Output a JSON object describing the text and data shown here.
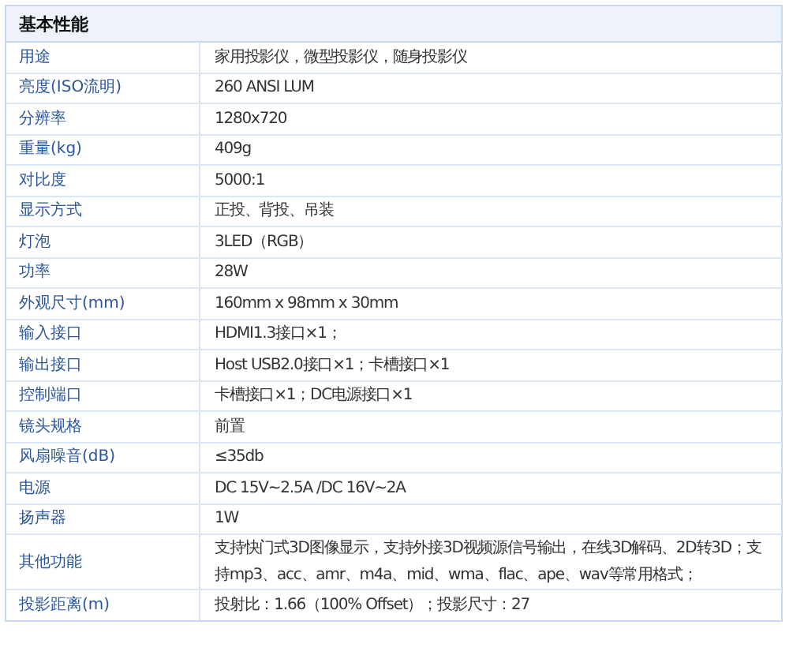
{
  "section_title": "基本性能",
  "rows": [
    {
      "label": "用途",
      "value": "家用投影仪，微型投影仪，随身投影仪"
    },
    {
      "label": "亮度(ISO流明)",
      "value": "260 ANSI LUM"
    },
    {
      "label": "分辨率",
      "value": "1280x720"
    },
    {
      "label": "重量(kg)",
      "value": "409g"
    },
    {
      "label": "对比度",
      "value": "5000:1"
    },
    {
      "label": "显示方式",
      "value": "正投、背投、吊装"
    },
    {
      "label": "灯泡",
      "value": "3LED（RGB）"
    },
    {
      "label": "功率",
      "value": "28W"
    },
    {
      "label": "外观尺寸(mm)",
      "value": "160mm x 98mm x 30mm"
    },
    {
      "label": "输入接口",
      "value": "HDMI1.3接口×1；"
    },
    {
      "label": "输出接口",
      "value": "Host USB2.0接口×1；卡槽接口×1"
    },
    {
      "label": "控制端口",
      "value": "卡槽接口×1；DC电源接口×1"
    },
    {
      "label": "镜头规格",
      "value": "前置"
    },
    {
      "label": "风扇噪音(dB)",
      "value": "≤35db"
    },
    {
      "label": "电源",
      "value": "DC 15V~2.5A /DC 16V~2A"
    },
    {
      "label": "扬声器",
      "value": "1W"
    },
    {
      "label": "其他功能",
      "value": "支持快门式3D图像显示，支持外接3D视频源信号输出，在线3D解码、2D转3D；支持mp3、acc、amr、m4a、mid、wma、flac、ape、wav等常用格式；"
    },
    {
      "label": "投影距离(m)",
      "value": "投射比：1.66（100% Offset）；投影尺寸：27"
    }
  ]
}
